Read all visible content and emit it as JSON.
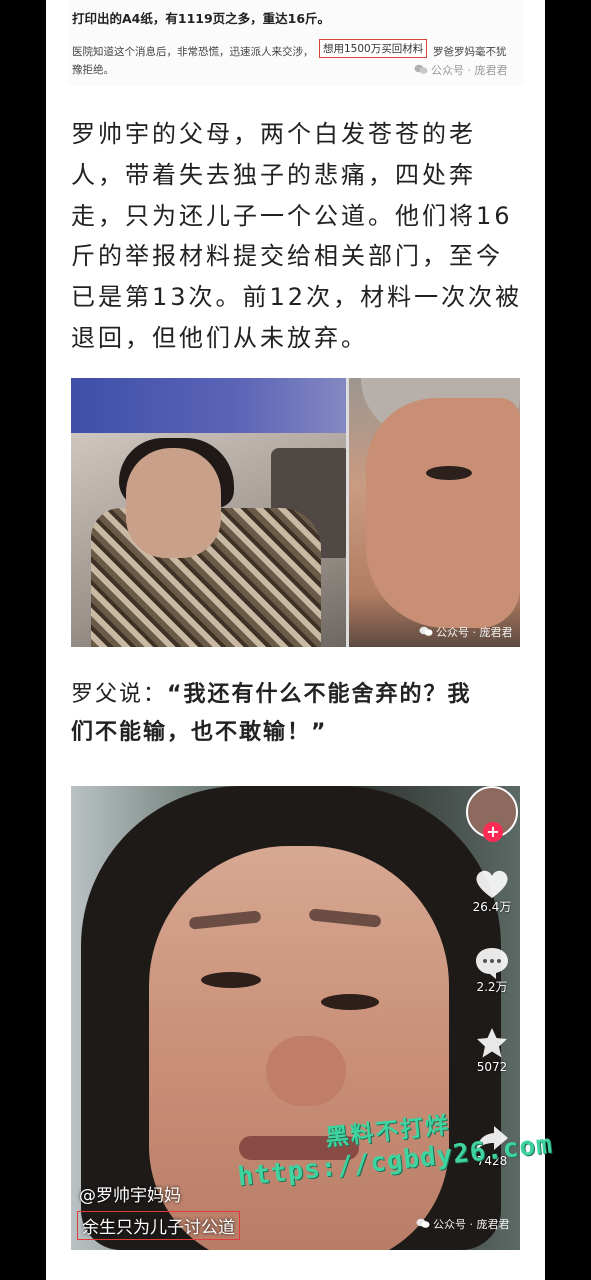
{
  "article_clip": {
    "heading": "打印出的A4纸，有1119页之多，重达16斤。",
    "line1_lead": "医院知道这个消息后，非常恐慌，迅速派人来交涉，",
    "line1_highlight": "想用1500万买回材料",
    "line1_tail": "罗爸罗妈毫不犹",
    "line2": "豫拒绝。",
    "watermark": "公众号 · 庞君君"
  },
  "paragraph": {
    "lines": [
      "罗帅宇的父母，两个白发苍苍的老",
      "人，带着失去独子的悲痛，四处奔",
      "走，只为还儿子一个公道。他们将16",
      "斤的举报材料提交给相关部门，至今",
      "已是第13次。前12次，材料一次次被",
      "退回，但他们从未放弃。"
    ]
  },
  "photo1": {
    "watermark": "公众号 · 庞君君"
  },
  "quote": {
    "speaker": "罗父说：",
    "line1": "“我还有什么不能舍弃的？我",
    "line2": "们不能输，也不敢输！”"
  },
  "video": {
    "likes": "26.4万",
    "comments": "2.2万",
    "favorites": "5072",
    "shares": "7428",
    "handle": "@罗帅宇妈妈",
    "caption": "余生只为儿子讨公道",
    "watermark": "公众号 · 庞君君",
    "icons": [
      "heart-icon",
      "comment-icon",
      "star-icon",
      "share-icon"
    ]
  },
  "overlay": {
    "line1": "黑料不打烊",
    "line2": "https://cgbdy26.com"
  },
  "colors": {
    "highlight_border": "#d9443a",
    "follow_button": "#fe2c55",
    "overlay_text": "#3fd3a0"
  }
}
